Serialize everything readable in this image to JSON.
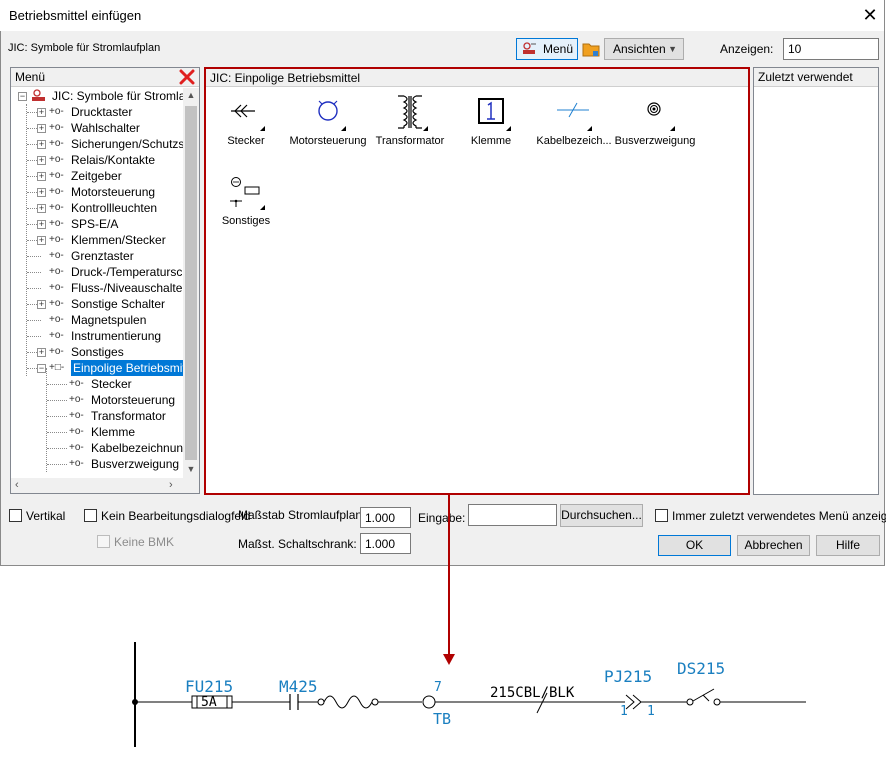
{
  "window": {
    "title": "Betriebsmittel einfügen",
    "close": "✕"
  },
  "toolbar": {
    "library_label": "JIC: Symbole für Stromlaufplan",
    "menu_button": "Menü",
    "views_button": "Ansichten",
    "show_label": "Anzeigen:",
    "show_value": "10"
  },
  "menu_panel": {
    "title": "Menü",
    "root": "JIC: Symbole für Stromlaufp",
    "items": [
      {
        "label": "Drucktaster",
        "expandable": true
      },
      {
        "label": "Wahlschalter",
        "expandable": true
      },
      {
        "label": "Sicherungen/Schutzsc",
        "expandable": true
      },
      {
        "label": "Relais/Kontakte",
        "expandable": true
      },
      {
        "label": "Zeitgeber",
        "expandable": true
      },
      {
        "label": "Motorsteuerung",
        "expandable": true
      },
      {
        "label": "Kontrollleuchten",
        "expandable": true
      },
      {
        "label": "SPS-E/A",
        "expandable": true
      },
      {
        "label": "Klemmen/Stecker",
        "expandable": true
      },
      {
        "label": "Grenztaster",
        "expandable": false
      },
      {
        "label": "Druck-/Temperatursch",
        "expandable": false
      },
      {
        "label": "Fluss-/Niveauschalter",
        "expandable": false
      },
      {
        "label": "Sonstige Schalter",
        "expandable": true
      },
      {
        "label": "Magnetspulen",
        "expandable": false
      },
      {
        "label": "Instrumentierung",
        "expandable": false
      },
      {
        "label": "Sonstiges",
        "expandable": true
      },
      {
        "label": "Einpolige Betriebsmittel",
        "expandable": true,
        "selected": true
      }
    ],
    "children": [
      "Stecker",
      "Motorsteuerung",
      "Transformator",
      "Klemme",
      "Kabelbezeichnung",
      "Busverzweigung"
    ]
  },
  "center_panel": {
    "title": "JIC: Einpolige Betriebsmittel",
    "symbols": [
      "Stecker",
      "Motorsteuerung",
      "Transformator",
      "Klemme",
      "Kabelbezeich...",
      "Busverzweigung",
      "Sonstiges"
    ]
  },
  "recent_panel": {
    "title": "Zuletzt verwendet"
  },
  "options": {
    "vertical": "Vertikal",
    "no_edit_dialog": "Kein Bearbeitungsdialogfeld",
    "no_bmk": "Keine BMK",
    "scale_label": "Maßstab Stromlaufplan:",
    "scale_value": "1.000",
    "cabinet_label": "Maßst. Schaltschrank:",
    "cabinet_value": "1.000",
    "input_label": "Eingabe:",
    "input_value": "",
    "browse": "Durchsuchen...",
    "always_recent": "Immer zuletzt verwendetes Menü anzeigen",
    "ok": "OK",
    "cancel": "Abbrechen",
    "help": "Hilfe"
  },
  "schematic": {
    "fuse_tag": "FU215",
    "fuse_value": "5A",
    "motor_tag": "M425",
    "terminal_number": "7",
    "terminal_tag": "TB",
    "cable_tag": "215CBL/BLK",
    "plug_tag": "PJ215",
    "plug_pin_left": "1",
    "plug_pin_right": "1",
    "switch_tag": "DS215"
  },
  "colors": {
    "highlight_border": "#b00000",
    "cad_text": "#1a7fc0",
    "selection": "#0078d7",
    "delete_x": "#e02020"
  }
}
